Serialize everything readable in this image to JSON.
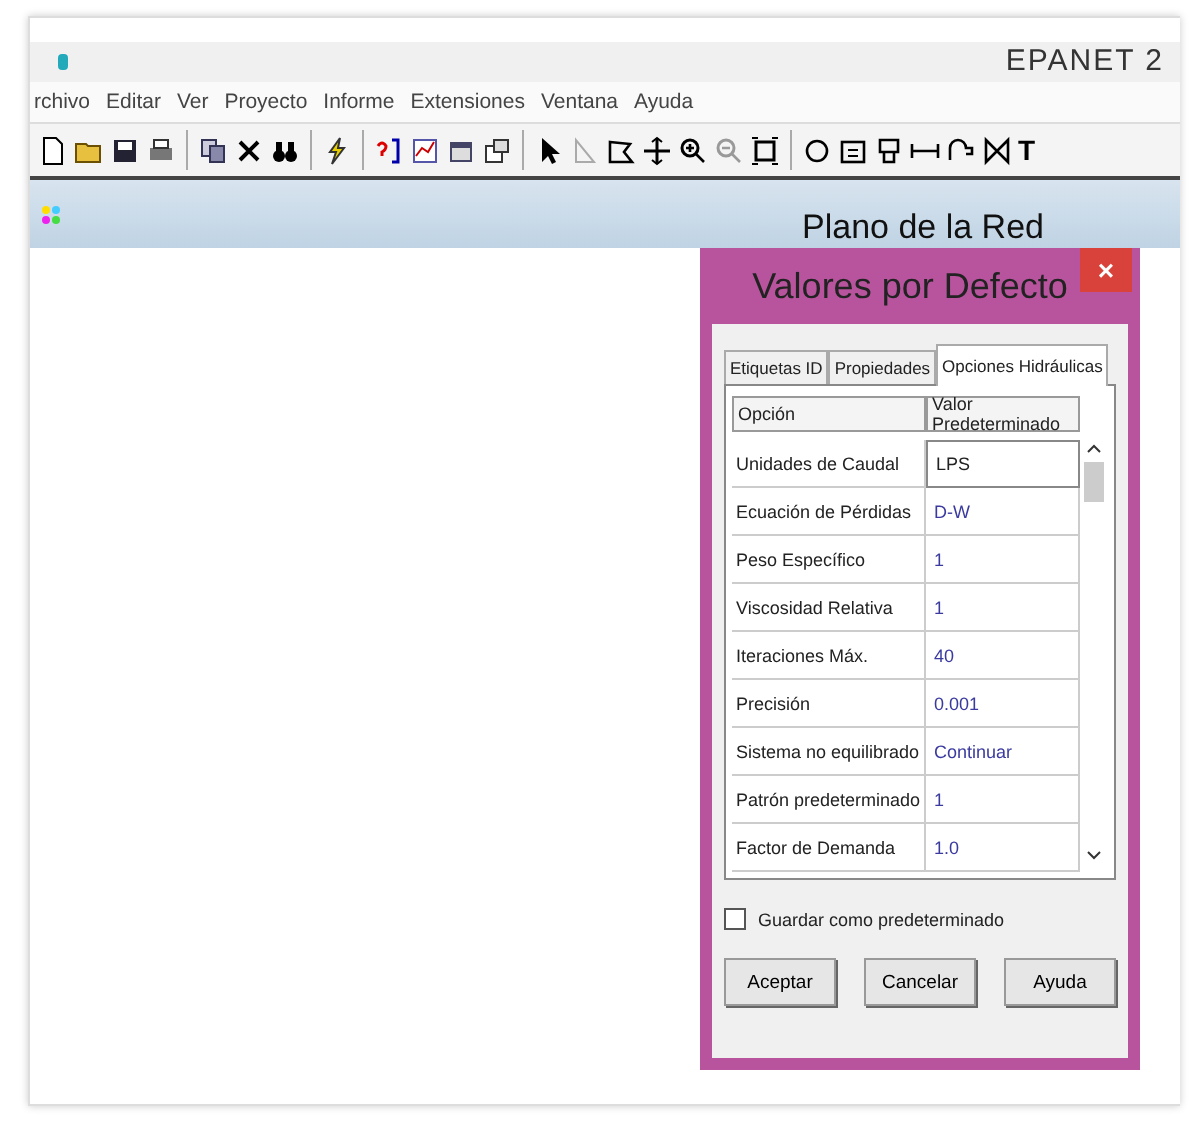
{
  "window": {
    "title": "EPANET 2"
  },
  "menu": [
    "rchivo",
    "Editar",
    "Ver",
    "Proyecto",
    "Informe",
    "Extensiones",
    "Ventana",
    "Ayuda"
  ],
  "toolbar": {
    "text_tool": "T"
  },
  "map": {
    "title": "Plano de la Red"
  },
  "dialog": {
    "title": "Valores por Defecto",
    "close": "×",
    "tabs": [
      {
        "label": "Etiquetas ID",
        "selected": false
      },
      {
        "label": "Propiedades",
        "selected": false
      },
      {
        "label": "Opciones Hidráulicas",
        "selected": true
      }
    ],
    "columns": [
      "Opción",
      "Valor Predeterminado"
    ],
    "rows": [
      {
        "option": "Unidades de Caudal",
        "value": "LPS",
        "kind": "edit"
      },
      {
        "option": "Ecuación de Pérdidas",
        "value": "D-W",
        "kind": "value"
      },
      {
        "option": "Peso Específico",
        "value": "1",
        "kind": "value"
      },
      {
        "option": "Viscosidad Relativa",
        "value": "1",
        "kind": "value"
      },
      {
        "option": "Iteraciones Máx.",
        "value": "40",
        "kind": "value"
      },
      {
        "option": "Precisión",
        "value": "0.001",
        "kind": "value"
      },
      {
        "option": "Sistema no equilibrado",
        "value": "Continuar",
        "kind": "value"
      },
      {
        "option": "Patrón predeterminado",
        "value": "1",
        "kind": "value"
      },
      {
        "option": "Factor de Demanda",
        "value": "1.0",
        "kind": "value"
      }
    ],
    "save_default": {
      "label": "Guardar como predeterminado",
      "checked": false
    },
    "buttons": [
      "Aceptar",
      "Cancelar",
      "Ayuda"
    ]
  }
}
